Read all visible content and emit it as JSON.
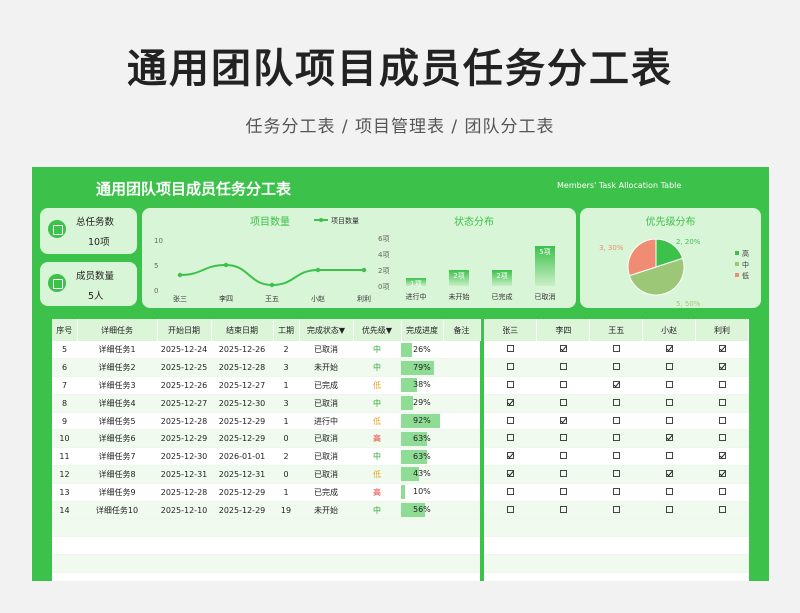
{
  "hero": {
    "title": "通用团队项目成员任务分工表",
    "subtitle": "任务分工表 / 项目管理表 / 团队分工表"
  },
  "sheet": {
    "title": "通用团队项目成员任务分工表",
    "title_en": "Members' Task Allocation Table",
    "accent": "#3cc14b"
  },
  "kpis": [
    {
      "label": "总任务数",
      "value": "10项",
      "icon": "database-icon"
    },
    {
      "label": "成员数量",
      "value": "5人",
      "icon": "database-icon"
    }
  ],
  "charts": {
    "count": {
      "title": "项目数量",
      "legend": "项目数量"
    },
    "status": {
      "title": "状态分布"
    },
    "priority": {
      "title": "优先级分布"
    }
  },
  "chart_data": [
    {
      "type": "line",
      "title": "项目数量",
      "categories": [
        "张三",
        "李四",
        "王五",
        "小赵",
        "利利"
      ],
      "series": [
        {
          "name": "项目数量",
          "values": [
            3,
            5,
            1,
            4,
            4
          ]
        }
      ],
      "yticks": [
        "0",
        "5",
        "10"
      ],
      "ylim": [
        0,
        10
      ]
    },
    {
      "type": "bar",
      "title": "状态分布",
      "categories": [
        "进行中",
        "未开始",
        "已完成",
        "已取消"
      ],
      "values": [
        1,
        2,
        2,
        5
      ],
      "value_labels": [
        "1项",
        "2项",
        "2项",
        "5项"
      ],
      "yticks": [
        "0项",
        "2项",
        "4项",
        "6项"
      ],
      "ylim": [
        0,
        6
      ]
    },
    {
      "type": "pie",
      "title": "优先级分布",
      "categories": [
        "高",
        "中",
        "低"
      ],
      "values": [
        2,
        5,
        3
      ],
      "slice_labels": [
        "2, 20%",
        "5, 50%",
        "3, 30%"
      ],
      "colors": [
        "#3cc14b",
        "#9cc777",
        "#f08c73"
      ]
    }
  ],
  "table": {
    "headers": [
      "序号",
      "详细任务",
      "开始日期",
      "结束日期",
      "工期",
      "完成状态▼",
      "优先级▼",
      "完成进度",
      "备注"
    ],
    "rows": [
      {
        "no": "5",
        "task": "详细任务1",
        "start": "2025-12-24",
        "end": "2025-12-26",
        "dur": "2",
        "status": "已取消",
        "pri": "中",
        "progress": 26,
        "progress_label": "26%",
        "note": ""
      },
      {
        "no": "6",
        "task": "详细任务2",
        "start": "2025-12-25",
        "end": "2025-12-28",
        "dur": "3",
        "status": "未开始",
        "pri": "中",
        "progress": 79,
        "progress_label": "79%",
        "note": ""
      },
      {
        "no": "7",
        "task": "详细任务3",
        "start": "2025-12-26",
        "end": "2025-12-27",
        "dur": "1",
        "status": "已完成",
        "pri": "低",
        "progress": 38,
        "progress_label": "38%",
        "note": ""
      },
      {
        "no": "8",
        "task": "详细任务4",
        "start": "2025-12-27",
        "end": "2025-12-30",
        "dur": "3",
        "status": "已取消",
        "pri": "中",
        "progress": 29,
        "progress_label": "29%",
        "note": ""
      },
      {
        "no": "9",
        "task": "详细任务5",
        "start": "2025-12-28",
        "end": "2025-12-29",
        "dur": "1",
        "status": "进行中",
        "pri": "低",
        "progress": 92,
        "progress_label": "92%",
        "note": ""
      },
      {
        "no": "10",
        "task": "详细任务6",
        "start": "2025-12-29",
        "end": "2025-12-29",
        "dur": "0",
        "status": "已取消",
        "pri": "高",
        "progress": 63,
        "progress_label": "63%",
        "note": ""
      },
      {
        "no": "11",
        "task": "详细任务7",
        "start": "2025-12-30",
        "end": "2026-01-01",
        "dur": "2",
        "status": "已取消",
        "pri": "中",
        "progress": 63,
        "progress_label": "63%",
        "note": ""
      },
      {
        "no": "12",
        "task": "详细任务8",
        "start": "2025-12-31",
        "end": "2025-12-31",
        "dur": "0",
        "status": "已取消",
        "pri": "低",
        "progress": 43,
        "progress_label": "43%",
        "note": ""
      },
      {
        "no": "13",
        "task": "详细任务9",
        "start": "2025-12-28",
        "end": "2025-12-29",
        "dur": "1",
        "status": "已完成",
        "pri": "高",
        "progress": 10,
        "progress_label": "10%",
        "note": ""
      },
      {
        "no": "14",
        "task": "详细任务10",
        "start": "2025-12-10",
        "end": "2025-12-29",
        "dur": "19",
        "status": "未开始",
        "pri": "中",
        "progress": 56,
        "progress_label": "56%",
        "note": ""
      }
    ],
    "priority_colors": {
      "高": "#e8352c",
      "中": "#2fa93a",
      "低": "#e8a21c"
    }
  },
  "members": {
    "headers": [
      "张三",
      "李四",
      "王五",
      "小赵",
      "利利"
    ],
    "checks": [
      [
        false,
        true,
        false,
        true,
        true
      ],
      [
        false,
        false,
        false,
        false,
        true
      ],
      [
        false,
        false,
        true,
        false,
        false
      ],
      [
        true,
        false,
        false,
        false,
        false
      ],
      [
        false,
        true,
        false,
        false,
        false
      ],
      [
        false,
        false,
        false,
        true,
        false
      ],
      [
        true,
        false,
        false,
        false,
        true
      ],
      [
        true,
        false,
        false,
        true,
        true
      ],
      [
        false,
        false,
        false,
        false,
        false
      ],
      [
        false,
        false,
        false,
        false,
        false
      ]
    ]
  }
}
